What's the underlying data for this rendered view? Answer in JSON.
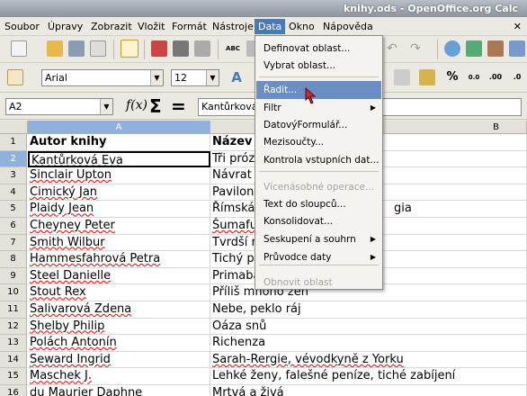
{
  "window": {
    "title": "knihy.ods - OpenOffice.org Calc"
  },
  "menubar": {
    "items": [
      "Soubor",
      "Úpravy",
      "Zobrazit",
      "Vložit",
      "Formát",
      "Nástroje",
      "Data",
      "Okno",
      "Nápověda"
    ],
    "active": "Data"
  },
  "toolbar2": {
    "font_name": "Arial",
    "font_size": "12"
  },
  "formula_bar": {
    "cell_ref": "A2",
    "content": "Kantůrková",
    "fx_icon": "function-wizard-icon",
    "sum_icon": "sum-icon",
    "equals_icon": "formula-icon"
  },
  "columns": {
    "a": "A",
    "b": "B"
  },
  "rows": [
    {
      "n": "1",
      "a": "Autor knihy",
      "b": "Název"
    },
    {
      "n": "2",
      "a": "Kantůrková Eva",
      "b": "Tři próz"
    },
    {
      "n": "3",
      "a": "Sinclair Upton",
      "b": "Návrat l"
    },
    {
      "n": "4",
      "a": "Cimický Jan",
      "b": "Pavilon"
    },
    {
      "n": "5",
      "a": "Plaidy Jean",
      "b": "Římská",
      "b2": "gia"
    },
    {
      "n": "6",
      "a": "Cheyney Peter",
      "b": "Šumafu"
    },
    {
      "n": "7",
      "a": "Smith Wilbur",
      "b": "Tvrdší r"
    },
    {
      "n": "8",
      "a": "Hammesfahrová Petra",
      "b": "Tichý pa"
    },
    {
      "n": "9",
      "a": "Steel Danielle",
      "b": "Primaba"
    },
    {
      "n": "10",
      "a": "Stout Rex",
      "b": "Příliš mnoho žen"
    },
    {
      "n": "11",
      "a": "Salivarová Zdena",
      "b": "Nebe, peklo ráj"
    },
    {
      "n": "12",
      "a": "Shelby Philip",
      "b": "Oáza snů"
    },
    {
      "n": "13",
      "a": "Polách Antonín",
      "b": "Richenza"
    },
    {
      "n": "14",
      "a": "Seward Ingrid",
      "b": "Sarah-Rergie, vévodkyně z Yorku"
    },
    {
      "n": "15",
      "a": "Maschek J.",
      "b": "Lehké ženy, falešné peníze, tiché zabíjení"
    },
    {
      "n": "16",
      "a": "du Maurier Daphne",
      "b": "Mrtvá a živá"
    }
  ],
  "data_menu": {
    "items": [
      {
        "label": "Definovat oblast...",
        "state": "normal"
      },
      {
        "label": "Vybrat oblast...",
        "state": "normal"
      },
      {
        "label": "Řadit...",
        "state": "highlighted"
      },
      {
        "label": "Filtr",
        "state": "submenu"
      },
      {
        "label": "DatovýFormulář...",
        "state": "normal"
      },
      {
        "label": "Mezisoučty...",
        "state": "normal"
      },
      {
        "label": "Kontrola vstupních dat...",
        "state": "normal"
      },
      {
        "label": "Vícenásobné operace...",
        "state": "disabled"
      },
      {
        "label": "Text do sloupců...",
        "state": "normal"
      },
      {
        "label": "Konsolidovat...",
        "state": "normal"
      },
      {
        "label": "Seskupení a souhrn",
        "state": "submenu"
      },
      {
        "label": "Průvodce daty",
        "state": "submenu"
      },
      {
        "label": "Obnovit oblast",
        "state": "disabled"
      }
    ]
  },
  "colors": {
    "menu_highlight": "#6b8fc4",
    "active_menu": "#4a79b5",
    "selection_header": "#8fb1db"
  }
}
